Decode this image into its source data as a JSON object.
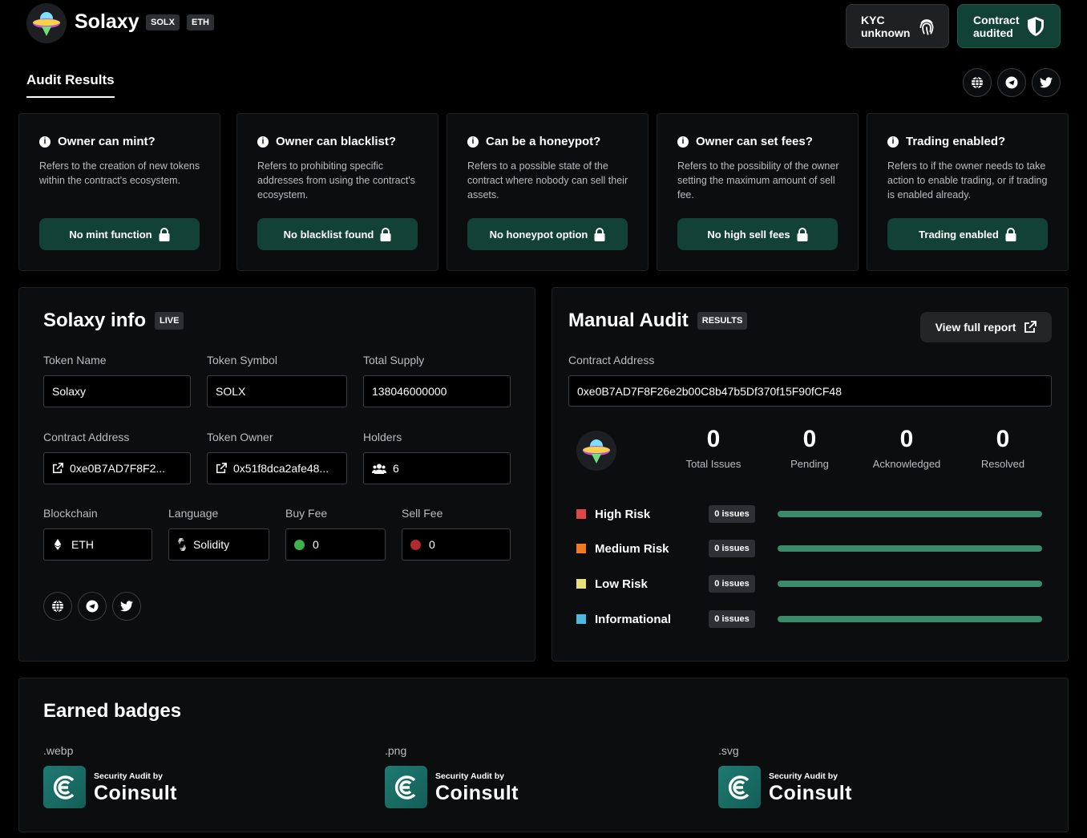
{
  "header": {
    "brand": "Solaxy",
    "tags": [
      "SOLX",
      "ETH"
    ],
    "kyc": {
      "line1": "KYC",
      "line2": "unknown",
      "icon": "fingerprint-icon"
    },
    "contract": {
      "line1": "Contract",
      "line2": "audited",
      "icon": "shield-icon"
    },
    "tab": "Audit Results",
    "social_icons": [
      "globe-icon",
      "telegram-icon",
      "twitter-icon"
    ]
  },
  "checks": [
    {
      "title": "Owner can mint?",
      "desc": "Refers to the creation of new tokens within the contract's ecosystem.",
      "result": "No mint function"
    },
    {
      "title": "Owner can blacklist?",
      "desc": "Refers to prohibiting specific addresses from using the contract's ecosystem.",
      "result": "No blacklist found"
    },
    {
      "title": "Can be a honeypot?",
      "desc": "Refers to a possible state of the contract where nobody can sell their assets.",
      "result": "No honeypot option"
    },
    {
      "title": "Owner can set fees?",
      "desc": "Refers to the possibility of the owner setting the maximum amount of sell fee.",
      "result": "No high sell fees"
    },
    {
      "title": "Trading enabled?",
      "desc": "Refers to if the owner needs to take action to enable trading, or if trading is enabled already.",
      "result": "Trading enabled"
    }
  ],
  "info": {
    "title": "Solaxy info",
    "tag": "LIVE",
    "token_name_label": "Token Name",
    "token_name": "Solaxy",
    "token_symbol_label": "Token Symbol",
    "token_symbol": "SOLX",
    "total_supply_label": "Total Supply",
    "total_supply": "138046000000",
    "contract_label": "Contract Address",
    "contract": "0xe0B7AD7F8F2...",
    "owner_label": "Token Owner",
    "owner": "0x51f8dca2afe48...",
    "holders_label": "Holders",
    "holders": "6",
    "blockchain_label": "Blockchain",
    "blockchain": "ETH",
    "language_label": "Language",
    "language": "Solidity",
    "buy_fee_label": "Buy Fee",
    "buy_fee": "0",
    "sell_fee_label": "Sell Fee",
    "sell_fee": "0"
  },
  "audit": {
    "title": "Manual Audit",
    "tag": "RESULTS",
    "view_report": "View full report",
    "contract_label": "Contract Address",
    "contract": "0xe0B7AD7F8F26e2b00C8b47b5Df370f15F90fCF48",
    "stats": [
      {
        "value": "0",
        "label": "Total Issues"
      },
      {
        "value": "0",
        "label": "Pending"
      },
      {
        "value": "0",
        "label": "Acknowledged"
      },
      {
        "value": "0",
        "label": "Resolved"
      }
    ],
    "risks": [
      {
        "name": "High Risk",
        "issues": "0 issues",
        "color": "#e04848",
        "progress": 1.0
      },
      {
        "name": "Medium Risk",
        "issues": "0 issues",
        "color": "#f07a22",
        "progress": 1.0
      },
      {
        "name": "Low Risk",
        "issues": "0 issues",
        "color": "#e8e07a",
        "progress": 1.0
      },
      {
        "name": "Informational",
        "issues": "0 issues",
        "color": "#4fb8e0",
        "progress": 1.0
      }
    ]
  },
  "badges": {
    "title": "Earned badges",
    "items": [
      {
        "format": ".webp",
        "small": "Security Audit by",
        "big": "Coinsult"
      },
      {
        "format": ".png",
        "small": "Security Audit by",
        "big": "Coinsult"
      },
      {
        "format": ".svg",
        "small": "Security Audit by",
        "big": "Coinsult"
      }
    ]
  },
  "colors": {
    "accent": "#124235",
    "bar": "#3a8a6b",
    "buy_dot": "#3db24a",
    "sell_dot": "#b02c2c"
  }
}
